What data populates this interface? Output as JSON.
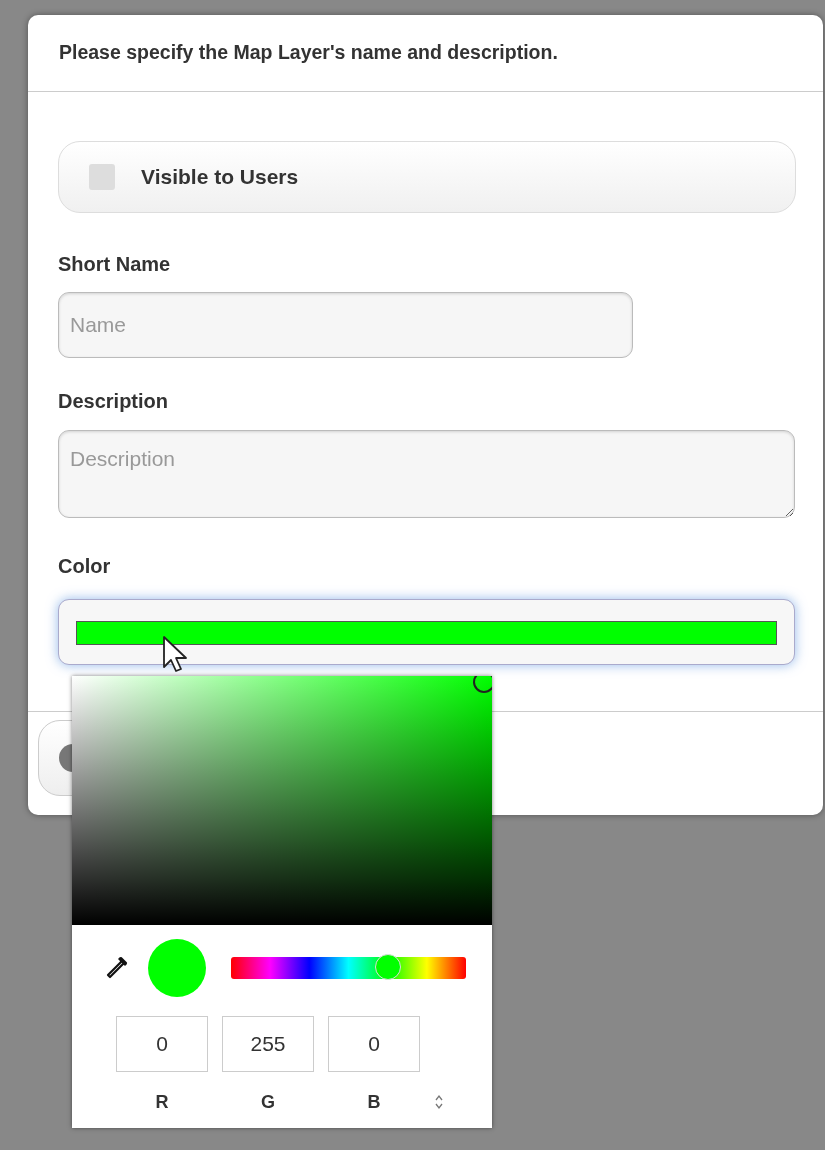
{
  "dialog": {
    "title": "Please specify the Map Layer's name and description.",
    "visible_toggle": {
      "label": "Visible to Users",
      "checked": false
    },
    "short_name": {
      "label": "Short Name",
      "placeholder": "Name"
    },
    "description": {
      "label": "Description",
      "placeholder": "Description"
    },
    "color": {
      "label": "Color"
    }
  },
  "color_picker": {
    "hue": {
      "level": 0.667
    },
    "channels": [
      {
        "label": "R",
        "value": "0"
      },
      {
        "label": "G",
        "value": "255"
      },
      {
        "label": "B",
        "value": "0"
      }
    ]
  }
}
